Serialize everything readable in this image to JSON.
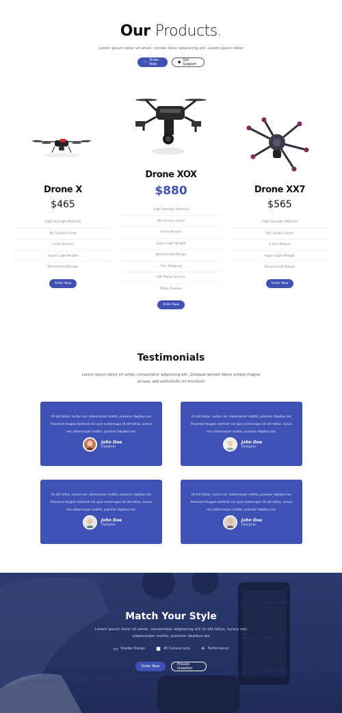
{
  "hero": {
    "title_bold": "Our",
    "title_light": "Products.",
    "subtitle": "Lorem ipsum dolor sit amet, consec tetur adipiscing elit. Lorem ipsum dolor",
    "order_label": "Order Now",
    "support_label": "Get Support"
  },
  "products": [
    {
      "name": "Drone X",
      "price": "$465",
      "features": [
        "High Strength Material",
        "4K Camera Lense",
        "4 Axis Powers",
        "Super Light Weight",
        "Streamlined Design"
      ],
      "button": "Order Now"
    },
    {
      "name": "Drone XOX",
      "price": "$880",
      "features": [
        "High Strength Material",
        "4K Camera Lense",
        "4 Axis Powers",
        "Super Light Weight",
        "Streamlined Design",
        "Free Shipping",
        "VIP Phone Service",
        "Other Feature"
      ],
      "button": "Order Now"
    },
    {
      "name": "Drone XX7",
      "price": "$565",
      "features": [
        "High Strength Material",
        "4K Camera Lense",
        "4 Axis Powers",
        "Super Light Weight",
        "Streamlined Design"
      ],
      "button": "Order Now"
    }
  ],
  "testimonials": {
    "title": "Testimonials",
    "subtitle": "Lorem ipsum dolor sit amet, consectetur adipiscing elit. Quisque laoreet libero ornare magna ornare, sed sollicitudin mi tincidunt",
    "items": [
      {
        "text": "Ut elit tellus, luctus nec ullamcorper mattis, pulvinar dapibus leo Praesent feugiat eleifend nisi quis scelerisque Ut elit tellus, luctus nec ullamcorper mattis, pulvinar dapibus leo.",
        "name": "John Doe",
        "role": "Designer"
      },
      {
        "text": "Ut elit tellus, luctus nec ullamcorper mattis, pulvinar dapibus leo Praesent feugiat eleifend nisi quis scelerisque Ut elit tellus, luctus nec ullamcorper mattis, pulvinar dapibus leo.",
        "name": "John Doe",
        "role": "Designer"
      },
      {
        "text": "Ut elit tellus, luctus nec ullamcorper mattis, pulvinar dapibus leo Praesent feugiat eleifend nisi quis scelerisque Ut elit tellus, luctus nec ullamcorper mattis, pulvinar dapibus leo.",
        "name": "John Doe",
        "role": "Designer"
      },
      {
        "text": "Ut elit tellus, luctus nec ullamcorper mattis, pulvinar dapibus leo Praesent feugiat eleifend nisi quis scelerisque Ut elit tellus, luctus nec ullamcorper mattis, pulvinar dapibus leo.",
        "name": "John Doe",
        "role": "Designer"
      }
    ]
  },
  "banner": {
    "title": "Match Your Style",
    "subtitle": "Lorem ipsum dolor sit amet, consectetur adipiscing elit Ut elit tellus, luctus nec ullamcorper mattis, pulvinar dapibus leo",
    "features": [
      {
        "icon": "monitor-icon",
        "label": "Sleeker Design"
      },
      {
        "icon": "video-camera-icon",
        "label": "4K Camera Lens"
      },
      {
        "icon": "airplane-icon",
        "label": "Performance"
      }
    ],
    "order_label": "Order Now",
    "presale_label": "Presale Question"
  },
  "colors": {
    "accent": "#3f51b5",
    "banner": "#253466"
  }
}
